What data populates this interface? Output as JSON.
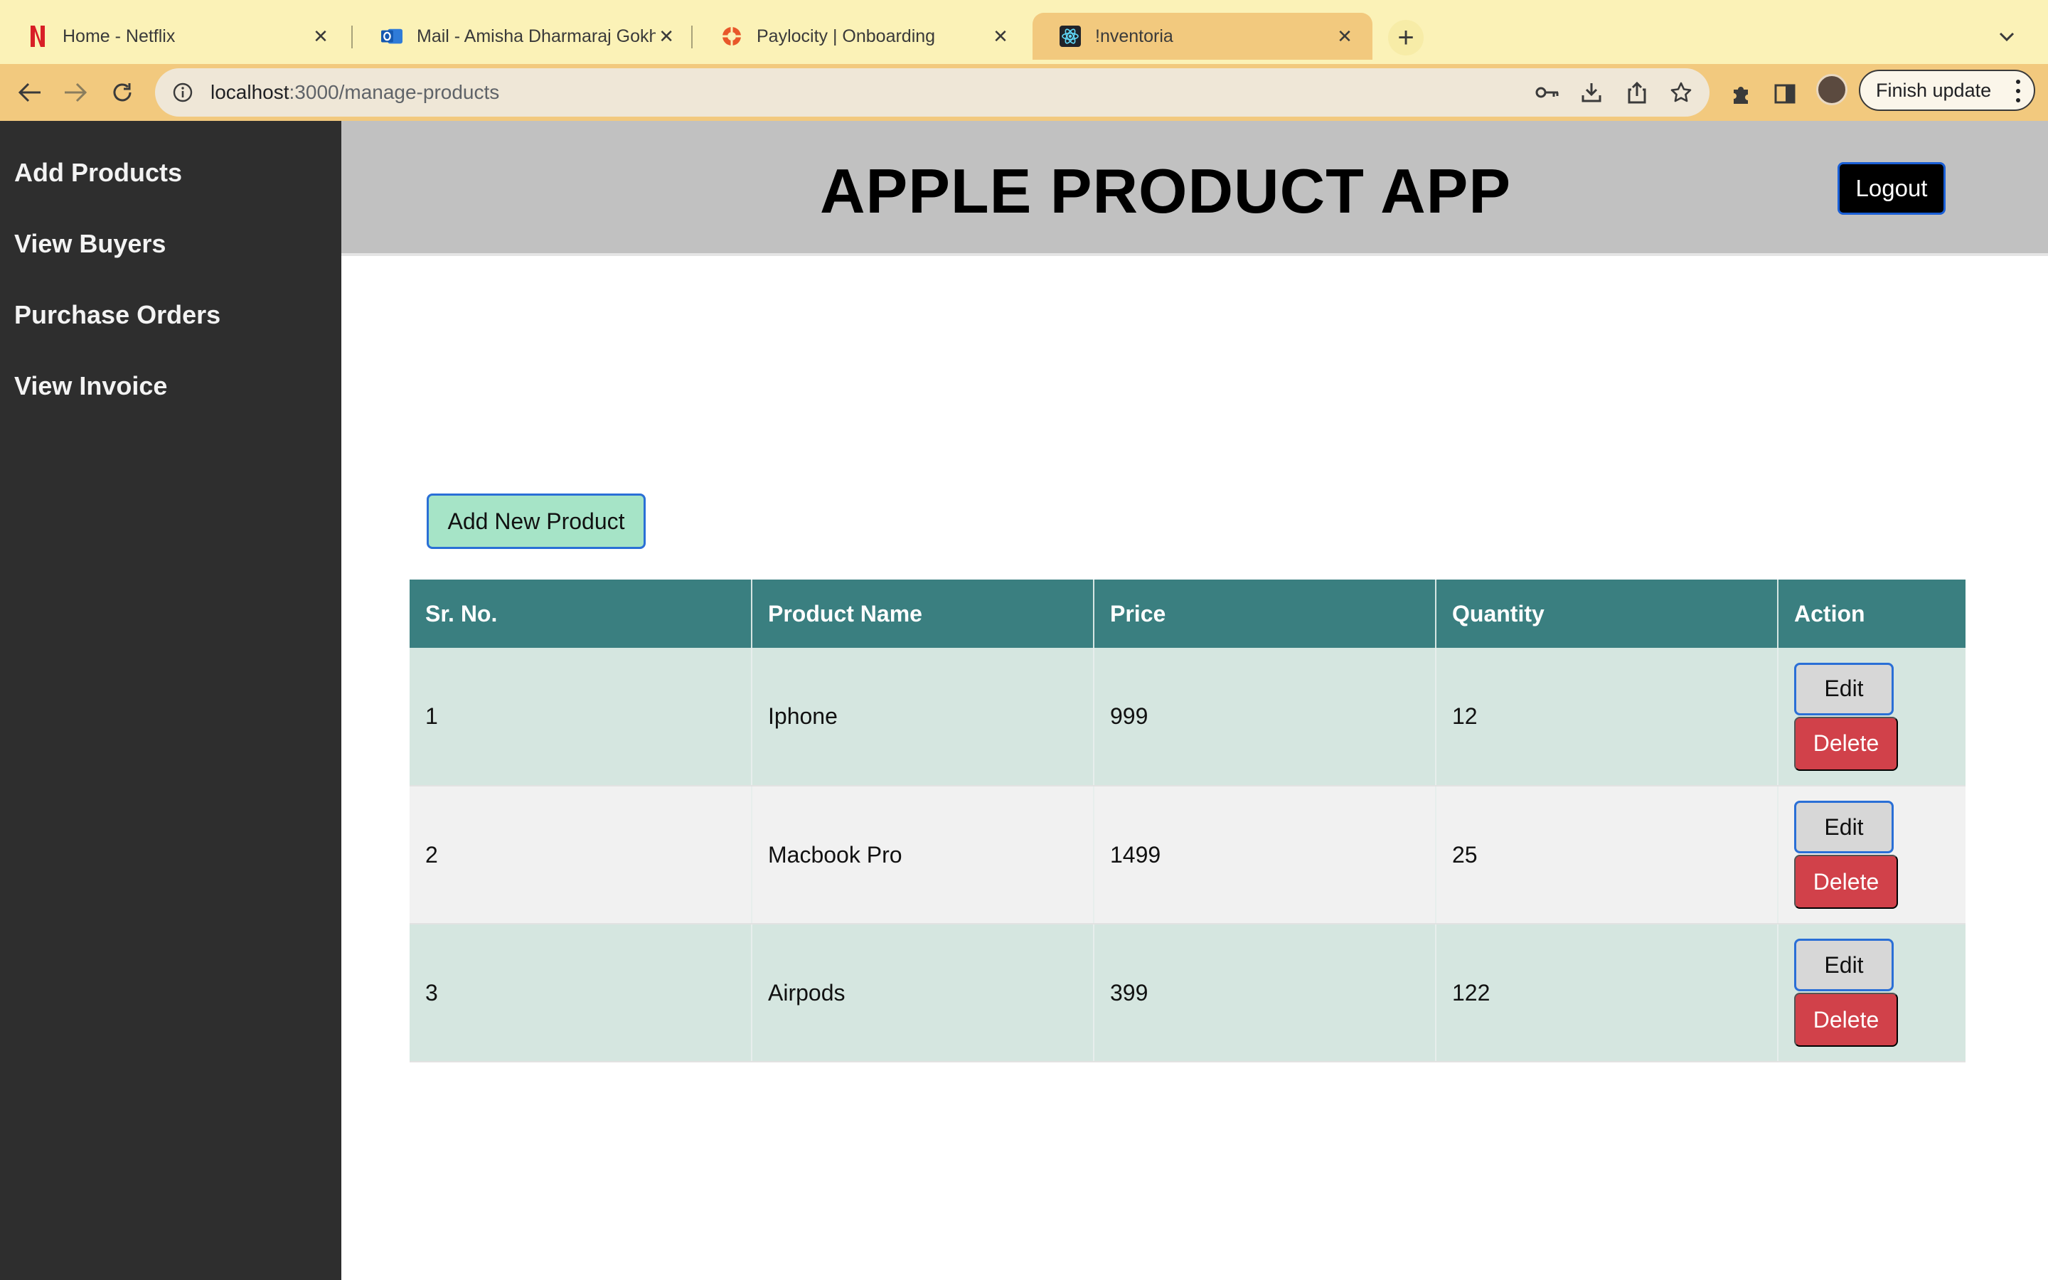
{
  "browser": {
    "tabs": [
      {
        "title": "Home - Netflix",
        "icon": "netflix-icon",
        "active": false
      },
      {
        "title": "Mail - Amisha Dharmaraj Gokh",
        "icon": "outlook-icon",
        "active": false
      },
      {
        "title": "Paylocity | Onboarding",
        "icon": "paylocity-icon",
        "active": false
      },
      {
        "title": "!nventoria",
        "icon": "react-icon",
        "active": true
      }
    ],
    "url_host": "localhost",
    "url_path": ":3000/manage-products",
    "finish_update_label": "Finish update"
  },
  "sidebar": {
    "items": [
      {
        "label": "Add Products"
      },
      {
        "label": "View Buyers"
      },
      {
        "label": "Purchase Orders"
      },
      {
        "label": "View Invoice"
      }
    ]
  },
  "header": {
    "title": "APPLE PRODUCT APP",
    "logout_label": "Logout"
  },
  "main": {
    "add_new_label": "Add New Product",
    "table": {
      "columns": [
        "Sr. No.",
        "Product Name",
        "Price",
        "Quantity",
        "Action"
      ],
      "rows": [
        {
          "sr": "1",
          "name": "Iphone",
          "price": "999",
          "quantity": "12"
        },
        {
          "sr": "2",
          "name": "Macbook Pro",
          "price": "1499",
          "quantity": "25"
        },
        {
          "sr": "3",
          "name": "Airpods",
          "price": "399",
          "quantity": "122"
        }
      ],
      "edit_label": "Edit",
      "delete_label": "Delete"
    }
  },
  "colors": {
    "tabstrip": "#fbf2b7",
    "toolbar": "#f2c97e",
    "sidebar": "#2e2e2e",
    "header": "#c1c1c1",
    "table_header": "#3a7f80",
    "row_odd": "#d5e6e0",
    "row_even": "#f1f1f1",
    "delete": "#d1414a",
    "add_button": "#a6e4c7"
  }
}
